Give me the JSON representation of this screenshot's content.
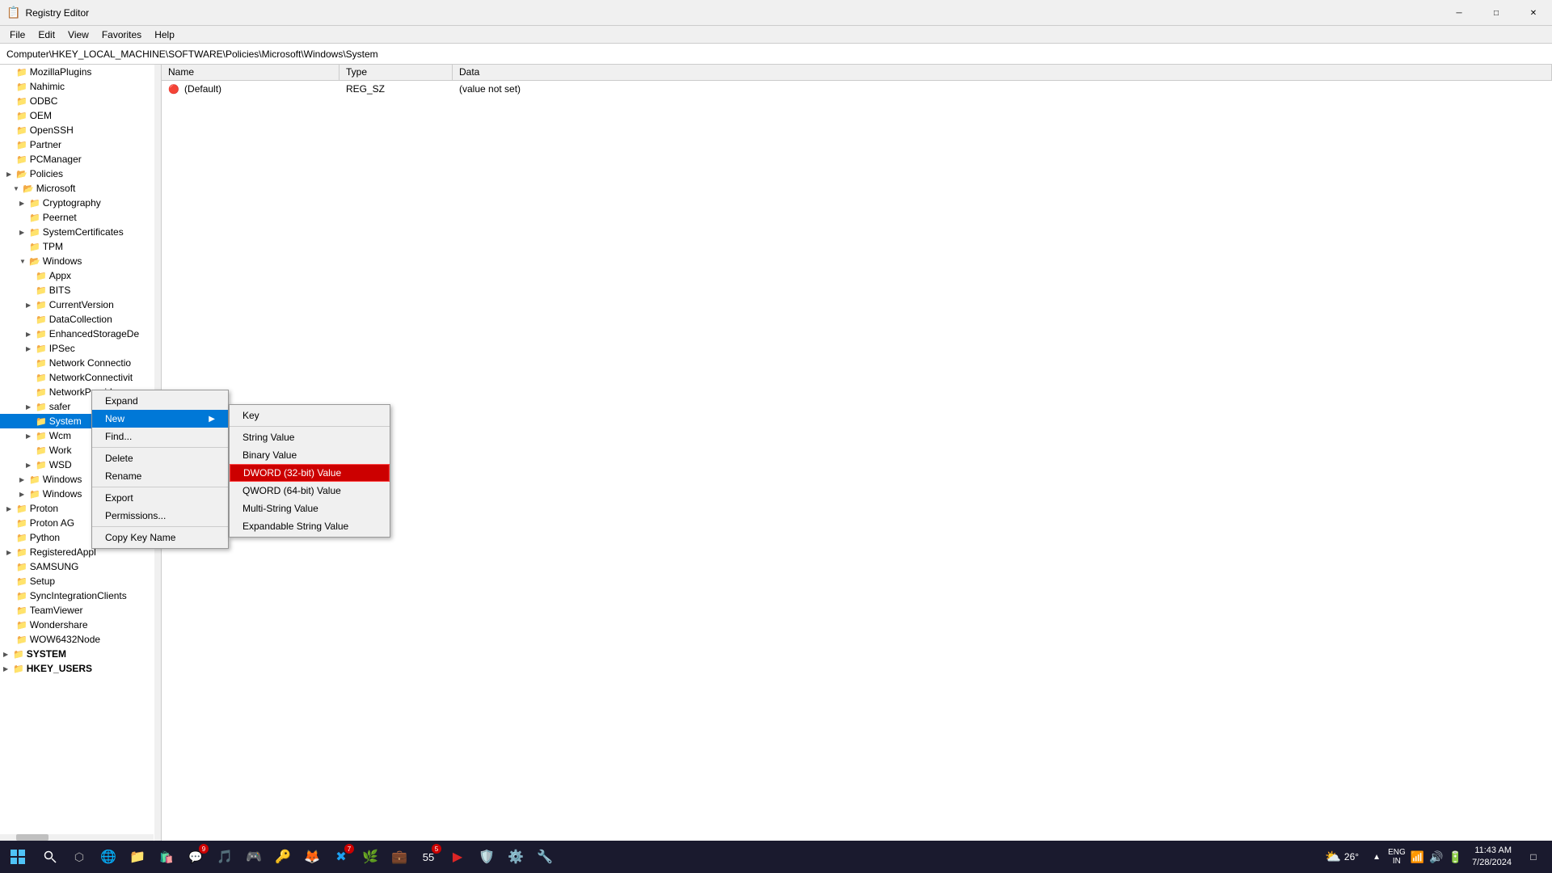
{
  "window": {
    "title": "Registry Editor",
    "min_btn": "─",
    "max_btn": "□",
    "close_btn": "✕"
  },
  "menu": {
    "items": [
      "File",
      "Edit",
      "View",
      "Favorites",
      "Help"
    ]
  },
  "address": {
    "label": "Computer\\HKEY_LOCAL_MACHINE\\SOFTWARE\\Policies\\Microsoft\\Windows\\System"
  },
  "tree": {
    "items": [
      {
        "label": "MozillaPlugins",
        "indent": 1,
        "arrow": "",
        "expanded": false
      },
      {
        "label": "Nahimic",
        "indent": 1,
        "arrow": "",
        "expanded": false
      },
      {
        "label": "ODBC",
        "indent": 1,
        "arrow": "",
        "expanded": false
      },
      {
        "label": "OEM",
        "indent": 1,
        "arrow": "",
        "expanded": false
      },
      {
        "label": "OpenSSH",
        "indent": 1,
        "arrow": "",
        "expanded": false
      },
      {
        "label": "Partner",
        "indent": 1,
        "arrow": "",
        "expanded": false
      },
      {
        "label": "PCManager",
        "indent": 1,
        "arrow": "",
        "expanded": false
      },
      {
        "label": "Policies",
        "indent": 1,
        "arrow": "▶",
        "expanded": true
      },
      {
        "label": "Microsoft",
        "indent": 2,
        "arrow": "▼",
        "expanded": true
      },
      {
        "label": "Cryptography",
        "indent": 3,
        "arrow": "▶",
        "expanded": false
      },
      {
        "label": "Peernet",
        "indent": 3,
        "arrow": "",
        "expanded": false
      },
      {
        "label": "SystemCertificates",
        "indent": 3,
        "arrow": "▶",
        "expanded": false
      },
      {
        "label": "TPM",
        "indent": 3,
        "arrow": "",
        "expanded": false
      },
      {
        "label": "Windows",
        "indent": 3,
        "arrow": "▼",
        "expanded": true
      },
      {
        "label": "Appx",
        "indent": 4,
        "arrow": "",
        "expanded": false
      },
      {
        "label": "BITS",
        "indent": 4,
        "arrow": "",
        "expanded": false
      },
      {
        "label": "CurrentVersion",
        "indent": 4,
        "arrow": "▶",
        "expanded": false
      },
      {
        "label": "DataCollection",
        "indent": 4,
        "arrow": "",
        "expanded": false
      },
      {
        "label": "EnhancedStorageDe",
        "indent": 4,
        "arrow": "▶",
        "expanded": false
      },
      {
        "label": "IPSec",
        "indent": 4,
        "arrow": "▶",
        "expanded": false
      },
      {
        "label": "Network Connectio",
        "indent": 4,
        "arrow": "",
        "expanded": false
      },
      {
        "label": "NetworkConnectivit",
        "indent": 4,
        "arrow": "",
        "expanded": false
      },
      {
        "label": "NetworkProvider",
        "indent": 4,
        "arrow": "",
        "expanded": false
      },
      {
        "label": "safer",
        "indent": 4,
        "arrow": "▶",
        "expanded": false
      },
      {
        "label": "System",
        "indent": 4,
        "arrow": "",
        "expanded": false,
        "selected": true
      },
      {
        "label": "Wcm",
        "indent": 4,
        "arrow": "▶",
        "expanded": false
      },
      {
        "label": "Work",
        "indent": 4,
        "arrow": "",
        "expanded": false
      },
      {
        "label": "WSD",
        "indent": 4,
        "arrow": "▶",
        "expanded": false
      },
      {
        "label": "Windows",
        "indent": 3,
        "arrow": "▶",
        "expanded": false
      },
      {
        "label": "Windows",
        "indent": 3,
        "arrow": "▶",
        "expanded": false
      },
      {
        "label": "Proton",
        "indent": 1,
        "arrow": "▶",
        "expanded": false
      },
      {
        "label": "Proton AG",
        "indent": 1,
        "arrow": "",
        "expanded": false
      },
      {
        "label": "Python",
        "indent": 1,
        "arrow": "",
        "expanded": false
      },
      {
        "label": "RegisteredAppl",
        "indent": 1,
        "arrow": "▶",
        "expanded": false
      },
      {
        "label": "SAMSUNG",
        "indent": 1,
        "arrow": "",
        "expanded": false
      },
      {
        "label": "Setup",
        "indent": 1,
        "arrow": "",
        "expanded": false
      },
      {
        "label": "SyncIntegrationClients",
        "indent": 1,
        "arrow": "",
        "expanded": false
      },
      {
        "label": "TeamViewer",
        "indent": 1,
        "arrow": "",
        "expanded": false
      },
      {
        "label": "Wondershare",
        "indent": 1,
        "arrow": "",
        "expanded": false
      },
      {
        "label": "WOW6432Node",
        "indent": 1,
        "arrow": "",
        "expanded": false
      },
      {
        "label": "SYSTEM",
        "indent": 0,
        "arrow": "▶",
        "expanded": false
      },
      {
        "label": "HKEY_USERS",
        "indent": 0,
        "arrow": "▶",
        "expanded": false
      }
    ]
  },
  "right_panel": {
    "columns": [
      "Name",
      "Type",
      "Data"
    ],
    "rows": [
      {
        "name": "(Default)",
        "type": "REG_SZ",
        "data": "(value not set)",
        "isDefault": true
      }
    ]
  },
  "context_menu_outer": {
    "items": [
      {
        "label": "Expand",
        "hasArrow": false,
        "separator_after": false
      },
      {
        "label": "New",
        "hasArrow": true,
        "highlighted": true,
        "separator_after": false
      },
      {
        "label": "Find...",
        "hasArrow": false,
        "separator_after": true
      },
      {
        "label": "Delete",
        "hasArrow": false,
        "separator_after": false
      },
      {
        "label": "Rename",
        "hasArrow": false,
        "separator_after": true
      },
      {
        "label": "Export",
        "hasArrow": false,
        "separator_after": false
      },
      {
        "label": "Permissions...",
        "hasArrow": false,
        "separator_after": true
      },
      {
        "label": "Copy Key Name",
        "hasArrow": false,
        "separator_after": false
      }
    ]
  },
  "submenu_new": {
    "items": [
      {
        "label": "Key",
        "separator_after": true
      },
      {
        "label": "String Value",
        "separator_after": false
      },
      {
        "label": "Binary Value",
        "separator_after": false
      },
      {
        "label": "DWORD (32-bit) Value",
        "highlighted": true,
        "separator_after": false
      },
      {
        "label": "QWORD (64-bit) Value",
        "separator_after": false
      },
      {
        "label": "Multi-String Value",
        "separator_after": false
      },
      {
        "label": "Expandable String Value",
        "separator_after": false
      }
    ]
  },
  "taskbar": {
    "weather": "26°",
    "clock_time": "11:43 AM",
    "clock_date": "7/28/2024",
    "lang": "ENG\nIN",
    "icons": [
      "⊞",
      "🔍",
      "🎮",
      "🌐",
      "📁",
      "⊞",
      "💬",
      "🎵",
      "🎮",
      "🎸",
      "🦊",
      "🎯",
      "🔧",
      "🎵",
      "🛡️",
      "🎵",
      "⚙️",
      "🎮"
    ]
  }
}
